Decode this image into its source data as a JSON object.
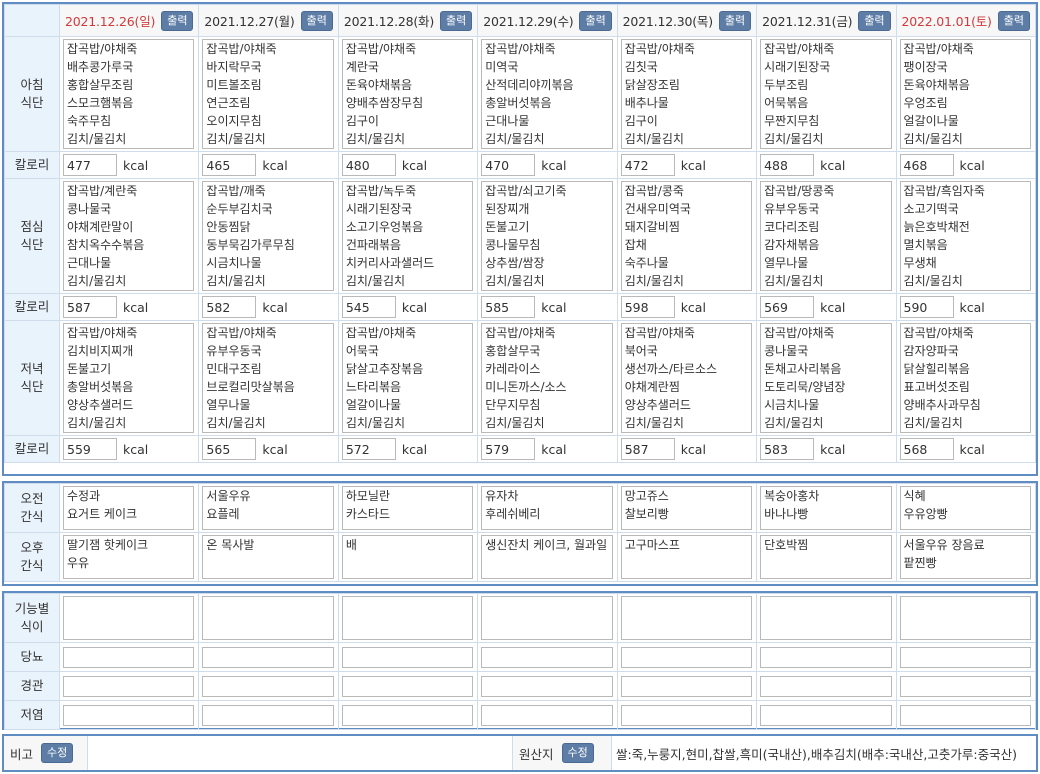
{
  "header": {
    "print_label": "출력",
    "days": [
      {
        "date": "2021.12.26(일)",
        "holiday": true
      },
      {
        "date": "2021.12.27(월)",
        "holiday": false
      },
      {
        "date": "2021.12.28(화)",
        "holiday": false
      },
      {
        "date": "2021.12.29(수)",
        "holiday": false
      },
      {
        "date": "2021.12.30(목)",
        "holiday": false
      },
      {
        "date": "2021.12.31(금)",
        "holiday": false
      },
      {
        "date": "2022.01.01(토)",
        "holiday": true
      }
    ]
  },
  "labels": {
    "breakfast": "아침\n식단",
    "lunch": "점심\n식단",
    "dinner": "저녁\n식단",
    "calorie": "칼로리",
    "kcal": "kcal",
    "am_snack": "오전\n간식",
    "pm_snack": "오후\n간식",
    "functional": "기능별\n식이",
    "diabetes": "당뇨",
    "tube": "경관",
    "low_salt": "저염",
    "note": "비고",
    "edit": "수정",
    "origin": "원산지"
  },
  "breakfast": [
    "잡곡밥/야채죽\n배추콩가루국\n홍합살무조림\n스모크햄볶음\n숙주무침\n김치/물김치",
    "잡곡밥/야채죽\n바지락무국\n미트볼조림\n연근조림\n오이지무침\n김치/물김치",
    "잡곡밥/야채죽\n계란국\n돈육야채볶음\n양배추쌈장무침\n김구이\n김치/물김치",
    "잡곡밥/야채죽\n미역국\n산적데리야끼볶음\n총알버섯볶음\n근대나물\n김치/물김치",
    "잡곡밥/야채죽\n김칫국\n닭살장조림\n배추나물\n김구이\n김치/물김치",
    "잡곡밥/야채죽\n시래기된장국\n두부조림\n어묵볶음\n무짠지무침\n김치/물김치",
    "잡곡밥/야채죽\n팽이장국\n돈육야채볶음\n우엉조림\n얼갈이나물\n김치/물김치"
  ],
  "breakfast_cal": [
    "477",
    "465",
    "480",
    "470",
    "472",
    "488",
    "468"
  ],
  "lunch": [
    "잡곡밥/계란죽\n콩나물국\n야채계란말이\n참치옥수수볶음\n근대나물\n김치/물김치",
    "잡곡밥/깨죽\n순두부김치국\n안동찜닭\n동부묵김가루무침\n시금치나물\n김치/물김치",
    "잡곡밥/녹두죽\n시래기된장국\n소고기우엉볶음\n건파래볶음\n치커리사과샐러드\n김치/물김치",
    "잡곡밥/쇠고기죽\n된장찌개\n돈불고기\n콩나물무침\n상추쌈/쌈장\n김치/물김치",
    "잡곡밥/콩죽\n건새우미역국\n돼지갈비찜\n잡채\n숙주나물\n김치/물김치",
    "잡곡밥/땅콩죽\n유부우동국\n코다리조림\n감자채볶음\n열무나물\n김치/물김치",
    "잡곡밥/흑임자죽\n소고기떡국\n늙은호박채전\n멸치볶음\n무생채\n김치/물김치"
  ],
  "lunch_cal": [
    "587",
    "582",
    "545",
    "585",
    "598",
    "569",
    "590"
  ],
  "dinner": [
    "잡곡밥/야채죽\n김치비지찌개\n돈불고기\n총알버섯볶음\n양상추샐러드\n김치/물김치",
    "잡곡밥/야채죽\n유부우동국\n민대구조림\n브로컬리맛살볶음\n열무나물\n김치/물김치",
    "잡곡밥/야채죽\n어묵국\n닭살고추장볶음\n느타리볶음\n얼갈이나물\n김치/물김치",
    "잡곡밥/야채죽\n홍합살무국\n카레라이스\n미니돈까스/소스\n단무지무침\n김치/물김치",
    "잡곡밥/야채죽\n북어국\n생선까스/타르소스\n야채계란찜\n양상추샐러드\n김치/물김치",
    "잡곡밥/야채죽\n콩나물국\n돈채고사리볶음\n도토리묵/양념장\n시금치나물\n김치/물김치",
    "잡곡밥/야채죽\n감자양파국\n닭살힐리볶음\n표고버섯조림\n양배추사과무침\n김치/물김치"
  ],
  "dinner_cal": [
    "559",
    "565",
    "572",
    "579",
    "587",
    "583",
    "568"
  ],
  "am_snack": [
    "수정과\n요거트 케이크",
    "서울우유\n요플레",
    "하모닐란\n카스타드",
    "유자차\n후레쉬베리",
    "망고쥬스\n찰보리빵",
    "복숭아홍차\n바나나빵",
    "식혜\n우유앙빵"
  ],
  "pm_snack": [
    "딸기잼 핫케이크\n우유",
    "온 목사발",
    "배",
    "생신잔치 케이크, 월과일",
    "고구마스프",
    "단호박찜",
    "서울우유 장음료\n팥찐빵"
  ],
  "origin_text": "쌀:죽,누룽지,현미,찹쌀,흑미(국내산),배추김치(배추:국내산,고춧가루:중국산)"
}
